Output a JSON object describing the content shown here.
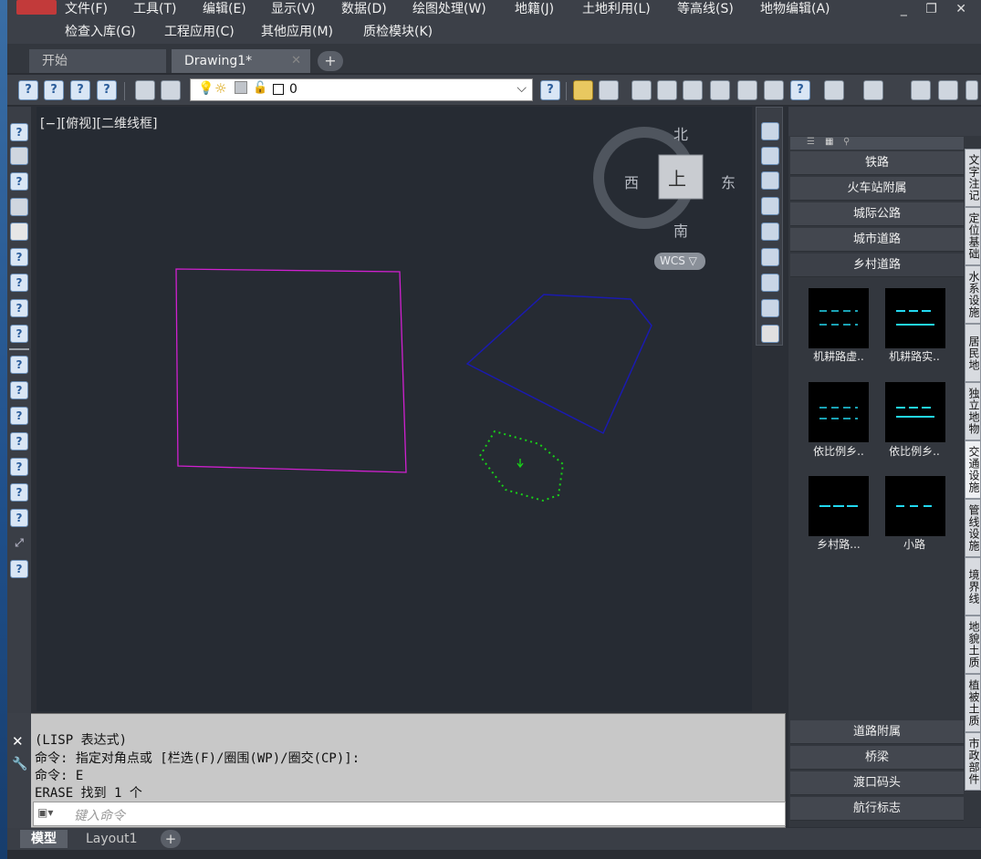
{
  "menubar": {
    "row1": [
      "文件(F)",
      "工具(T)",
      "编辑(E)",
      "显示(V)",
      "数据(D)",
      "绘图处理(W)",
      "地籍(J)",
      "土地利用(L)",
      "等高线(S)",
      "地物编辑(A)"
    ],
    "row2": [
      "检查入库(G)",
      "工程应用(C)",
      "其他应用(M)",
      "质检模块(K)"
    ],
    "window_controls": "_ ❐ ✕"
  },
  "tabs": {
    "items": [
      {
        "label": "开始"
      },
      {
        "label": "Drawing1*"
      }
    ],
    "close_glyph": "✕",
    "add_glyph": "+"
  },
  "toolbar": {
    "layer_value": "0",
    "combo_arrow": "⌵"
  },
  "canvas": {
    "view_label": "[−][俯视][二维线框]",
    "compass": {
      "north": "北",
      "south": "南",
      "east": "东",
      "west": "西",
      "top": "上"
    },
    "wcs_label": "WCS ▽"
  },
  "panel": {
    "categories_top": [
      "铁路",
      "火车站附属",
      "城际公路",
      "城市道路",
      "乡村道路"
    ],
    "symbols": [
      {
        "label": "机耕路虚..",
        "style": "dashed"
      },
      {
        "label": "机耕路实..",
        "style": "solid"
      },
      {
        "label": "依比例乡..",
        "style": "dashed"
      },
      {
        "label": "依比例乡..",
        "style": "solid"
      },
      {
        "label": "乡村路...",
        "style": "single-dash"
      },
      {
        "label": "小路",
        "style": "short-dash"
      }
    ],
    "categories_bottom": [
      "道路附属",
      "桥梁",
      "渡口码头",
      "航行标志"
    ],
    "side_tabs": [
      "文字注记",
      "定位基础",
      "水系设施",
      "居民地",
      "独立地物",
      "交通设施",
      "管线设施",
      "境界线",
      "地貌土质",
      "植被土质",
      "市政部件"
    ]
  },
  "command": {
    "lines": [
      "(LISP 表达式)",
      "命令: 指定对角点或 [栏选(F)/圈围(WP)/圈交(CP)]:",
      "命令: E",
      "ERASE 找到 1 个"
    ],
    "placeholder": "键入命令",
    "close_glyph": "✕"
  },
  "layouts": {
    "tabs": [
      "模型",
      "Layout1"
    ],
    "add_glyph": "+"
  },
  "colors": {
    "canvas_bg": "#262b33",
    "magenta_poly": "#d020d0",
    "blue_poly": "#1a1ab0",
    "green_poly": "#18d018",
    "symbol_cyan": "#22d8f0"
  }
}
